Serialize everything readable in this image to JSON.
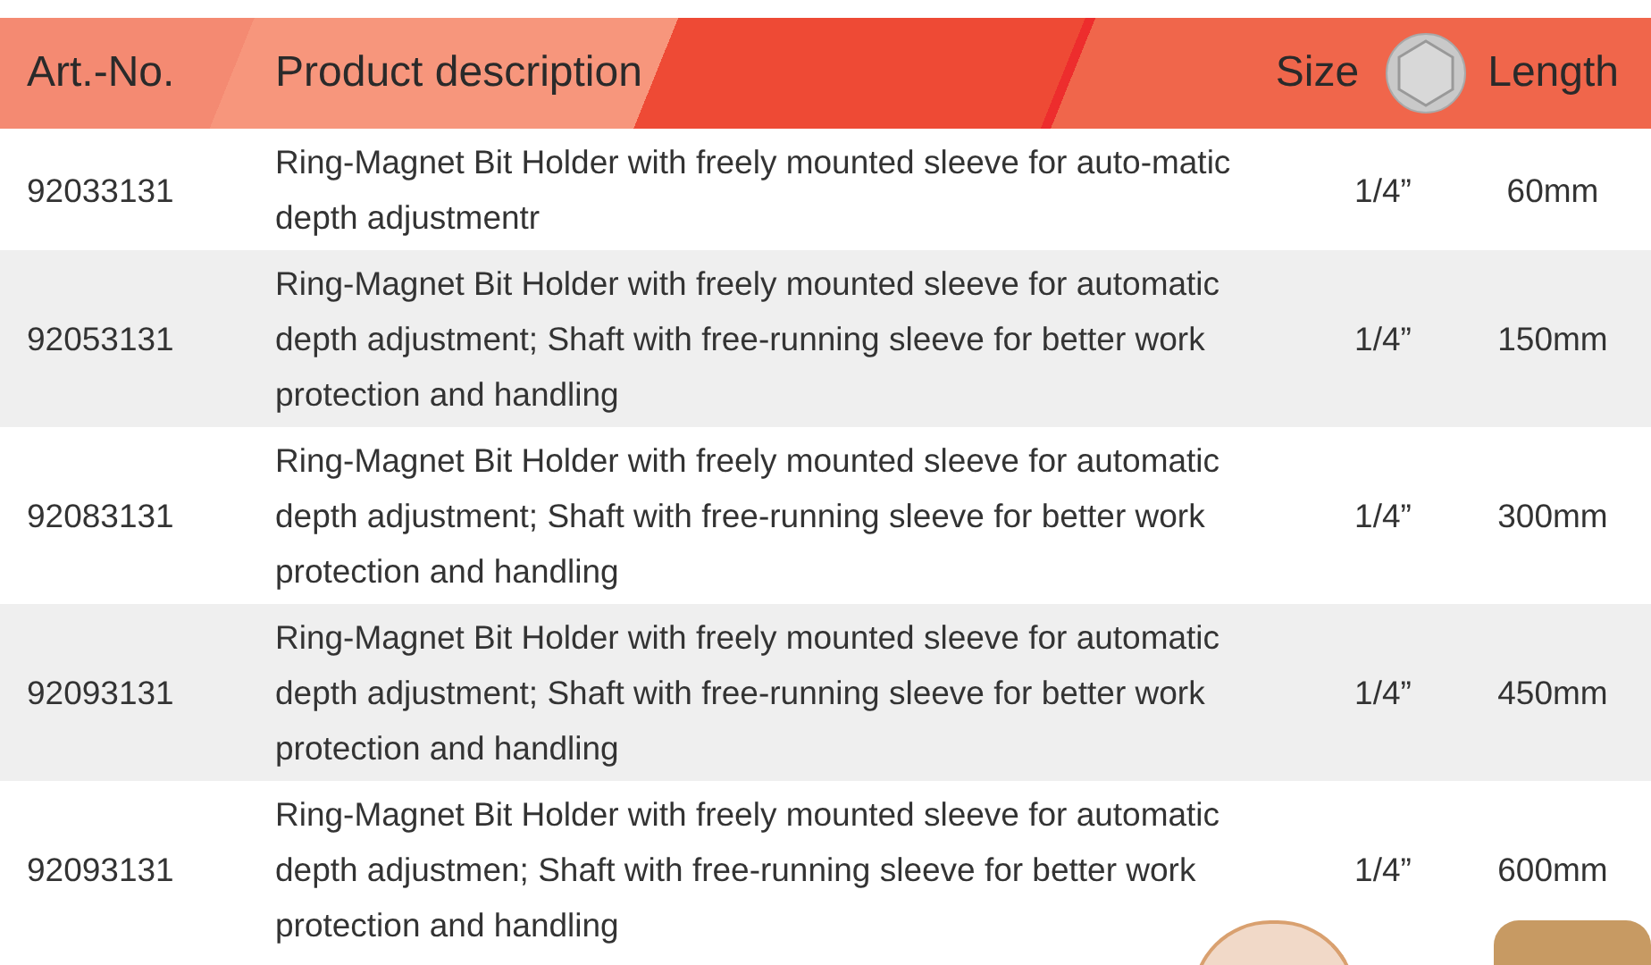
{
  "table": {
    "columns": [
      "Art.-No.",
      "Product description",
      "Size",
      "Length"
    ],
    "rows": [
      {
        "art_no": "92033131",
        "description": "Ring-Magnet Bit Holder with freely mounted sleeve for auto-matic depth adjustmentr",
        "size": "1/4”",
        "length": "60mm"
      },
      {
        "art_no": "92053131",
        "description": "Ring-Magnet Bit Holder with freely mounted sleeve for automatic depth adjustment; Shaft with free-running sleeve for better work protection and handling",
        "size": "1/4”",
        "length": "150mm"
      },
      {
        "art_no": "92083131",
        "description": "Ring-Magnet Bit Holder with freely mounted sleeve for automatic depth adjustment; Shaft with free-running sleeve for better work protection and handling",
        "size": "1/4”",
        "length": "300mm"
      },
      {
        "art_no": "92093131",
        "description": "Ring-Magnet Bit Holder with freely mounted sleeve for automatic depth adjustment; Shaft with free-running sleeve for better work protection and handling",
        "size": "1/4”",
        "length": "450mm"
      },
      {
        "art_no": "92093131",
        "description": "Ring-Magnet Bit Holder with freely mounted sleeve for automatic depth adjustmen; Shaft with free-running sleeve for better work protection and handling",
        "size": "1/4”",
        "length": "600mm"
      }
    ]
  }
}
